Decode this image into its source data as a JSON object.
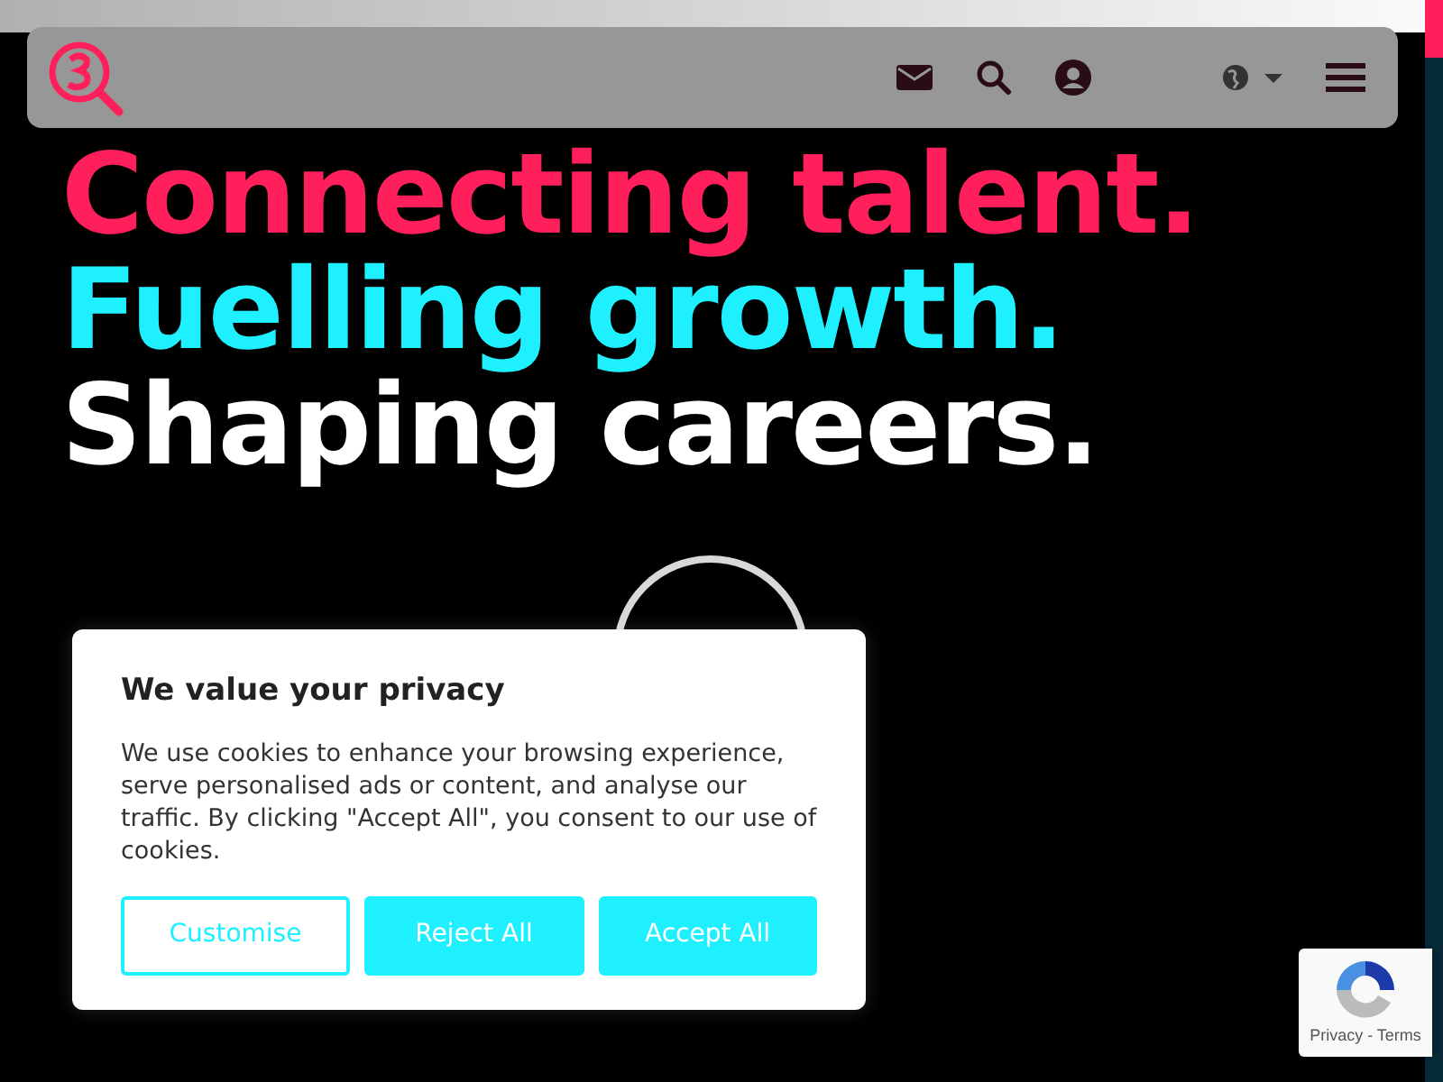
{
  "hero": {
    "headlines": [
      {
        "text": "Connecting talent.",
        "color": "#ff1f5a"
      },
      {
        "text": "Fuelling growth.",
        "color": "#1ff0ff"
      },
      {
        "text": "Shaping careers.",
        "color": "#ffffff"
      }
    ]
  },
  "cookie_dialog": {
    "title": "We value your privacy",
    "text": "We use cookies to enhance your browsing experience, serve personalised ads or content, and analyse our traffic. By clicking \"Accept All\", you consent to our use of cookies.",
    "buttons": [
      {
        "label": "Customise",
        "kind": "outline"
      },
      {
        "label": "Reject All",
        "kind": "filled"
      },
      {
        "label": "Accept All",
        "kind": "filled"
      }
    ]
  },
  "recaptcha": {
    "links": "Privacy - Terms"
  }
}
